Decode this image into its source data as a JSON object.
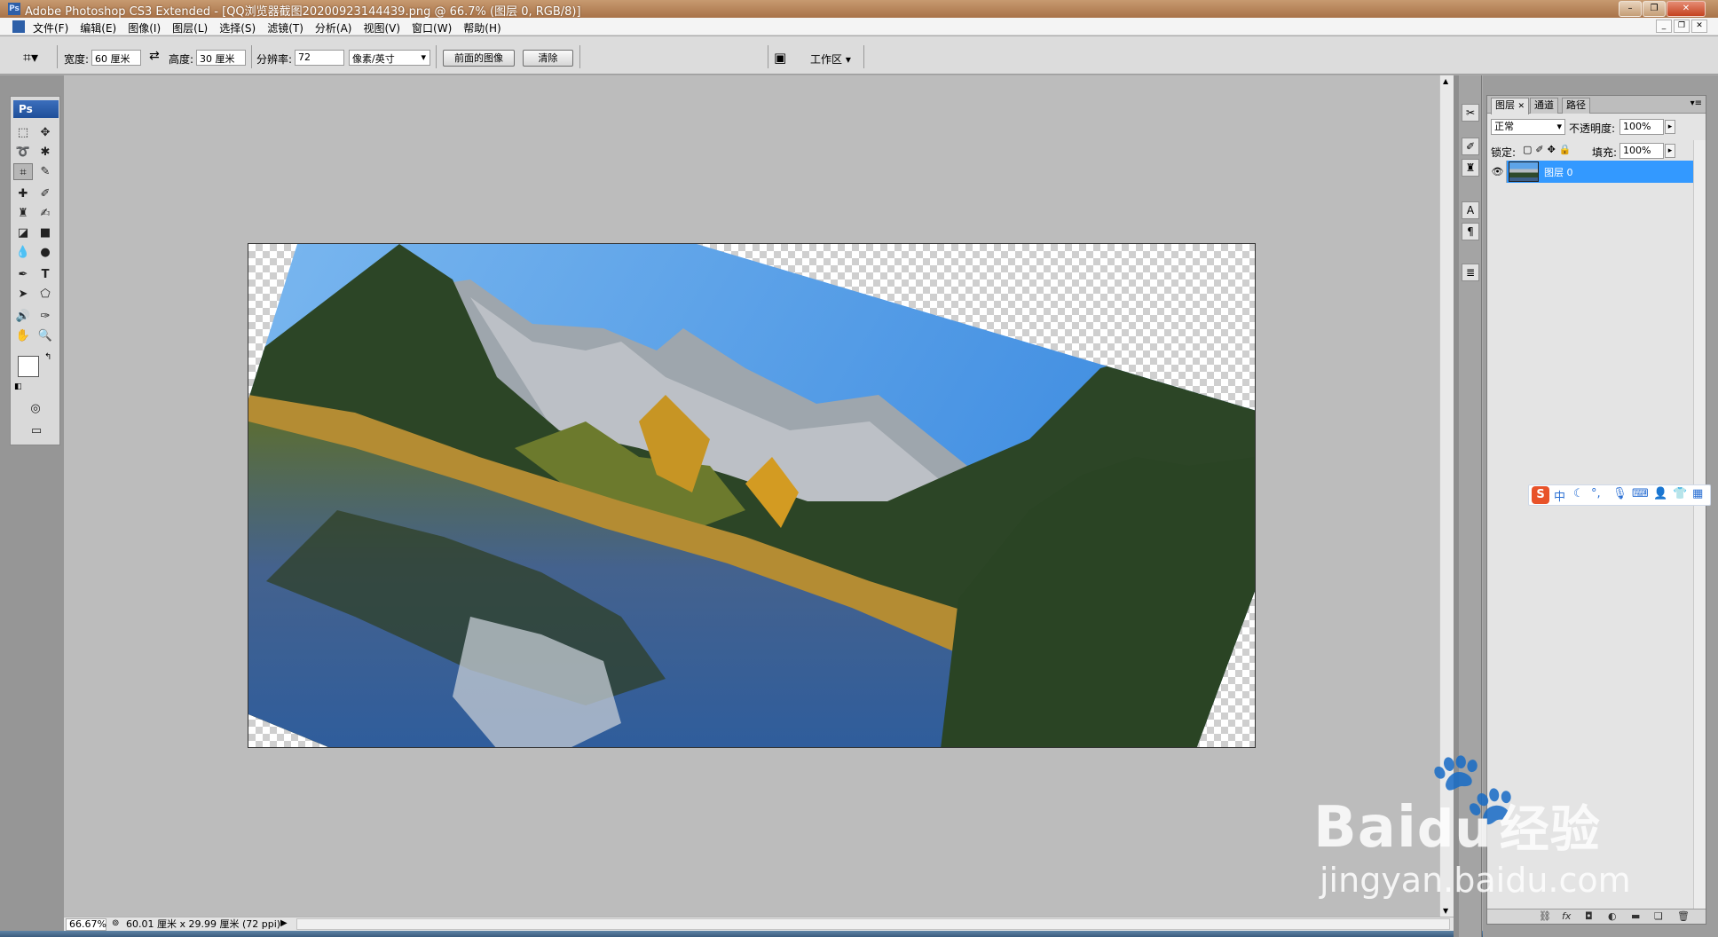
{
  "window": {
    "title": "Adobe Photoshop CS3 Extended - [QQ浏览器截图20200923144439.png @ 66.7% (图层 0, RGB/8)]",
    "app_icon": "Ps",
    "controls": [
      "minimize-icon",
      "restore-icon",
      "close-icon"
    ]
  },
  "menu": {
    "items": [
      "文件(F)",
      "编辑(E)",
      "图像(I)",
      "图层(L)",
      "选择(S)",
      "滤镜(T)",
      "分析(A)",
      "视图(V)",
      "窗口(W)",
      "帮助(H)"
    ]
  },
  "options": {
    "tool_icon": "crop-icon",
    "width_label": "宽度:",
    "width_value": "60 厘米",
    "swap_icon": "swap-icon",
    "height_label": "高度:",
    "height_value": "30 厘米",
    "resolution_label": "分辨率:",
    "resolution_value": "72",
    "resolution_unit": "像素/英寸",
    "front_image_button": "前面的图像",
    "clear_button": "清除",
    "workspace_label": "工作区"
  },
  "toolbox": {
    "logo": "Ps",
    "tools": [
      "marquee-icon",
      "move-icon",
      "lasso-icon",
      "magic-wand-icon",
      "crop-icon",
      "slice-icon",
      "healing-brush-icon",
      "brush-icon",
      "clone-stamp-icon",
      "history-brush-icon",
      "eraser-icon",
      "gradient-icon",
      "blur-icon",
      "dodge-icon",
      "pen-icon",
      "type-icon",
      "path-selection-icon",
      "shape-icon",
      "notes-icon",
      "eyedropper-icon",
      "hand-icon",
      "zoom-icon"
    ],
    "type_glyph": "T"
  },
  "status": {
    "zoom": "66.67%",
    "doc_info": "60.01 厘米 x 29.99 厘米 (72 ppi)"
  },
  "layers_panel": {
    "tabs": [
      "图层",
      "通道",
      "路径"
    ],
    "blend_mode": "正常",
    "opacity_label": "不透明度:",
    "opacity_value": "100%",
    "lock_label": "锁定:",
    "fill_label": "填充:",
    "fill_value": "100%",
    "layers": [
      {
        "name": "图层 0",
        "selected": true,
        "visible": true
      }
    ]
  },
  "ime": {
    "logo": "S",
    "mode": "中"
  },
  "watermark": {
    "brand": "Bai",
    "brand_tail": "经验",
    "url": "jingyan.baidu.com"
  },
  "colors": {
    "accent_selection": "#3399ff",
    "titlebar": "#b68560",
    "sky": "#4f9be6",
    "forest": "#2d4a26",
    "water": "#3a6aa3",
    "grass": "#b8902f"
  }
}
